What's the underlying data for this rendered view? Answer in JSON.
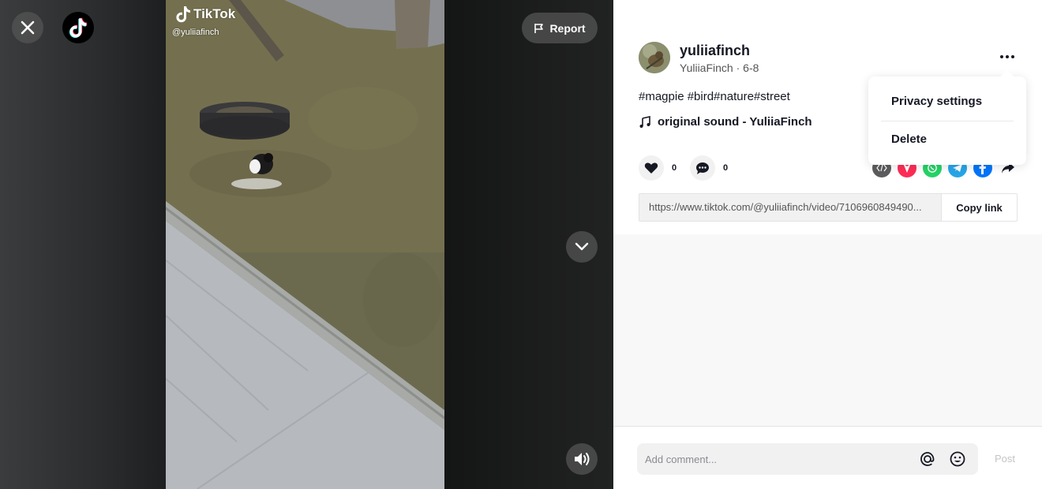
{
  "video": {
    "watermark_brand": "TikTok",
    "watermark_user": "@yuliiafinch",
    "report_label": "Report"
  },
  "post": {
    "username": "yuliiafinch",
    "nickname": "YuliiaFinch",
    "separator": " · ",
    "date": "6-8",
    "caption": "#magpie #bird#nature#street",
    "sound": "original sound - YuliiaFinch",
    "likes": "0",
    "comments": "0"
  },
  "share": {
    "link": "https://www.tiktok.com/@yuliiafinch/video/7106960849490...",
    "copy_label": "Copy link",
    "icons": [
      "embed-icon",
      "friends-icon",
      "whatsapp-icon",
      "telegram-icon",
      "facebook-icon",
      "share-arrow-icon"
    ],
    "colors": {
      "embed": "#5c5c5e",
      "friends": "#fe2c55",
      "whatsapp": "#25d366",
      "telegram": "#27a5e7",
      "facebook": "#0075fa"
    }
  },
  "menu": {
    "items": [
      "Privacy settings",
      "Delete"
    ]
  },
  "composer": {
    "placeholder": "Add comment...",
    "post_label": "Post"
  }
}
